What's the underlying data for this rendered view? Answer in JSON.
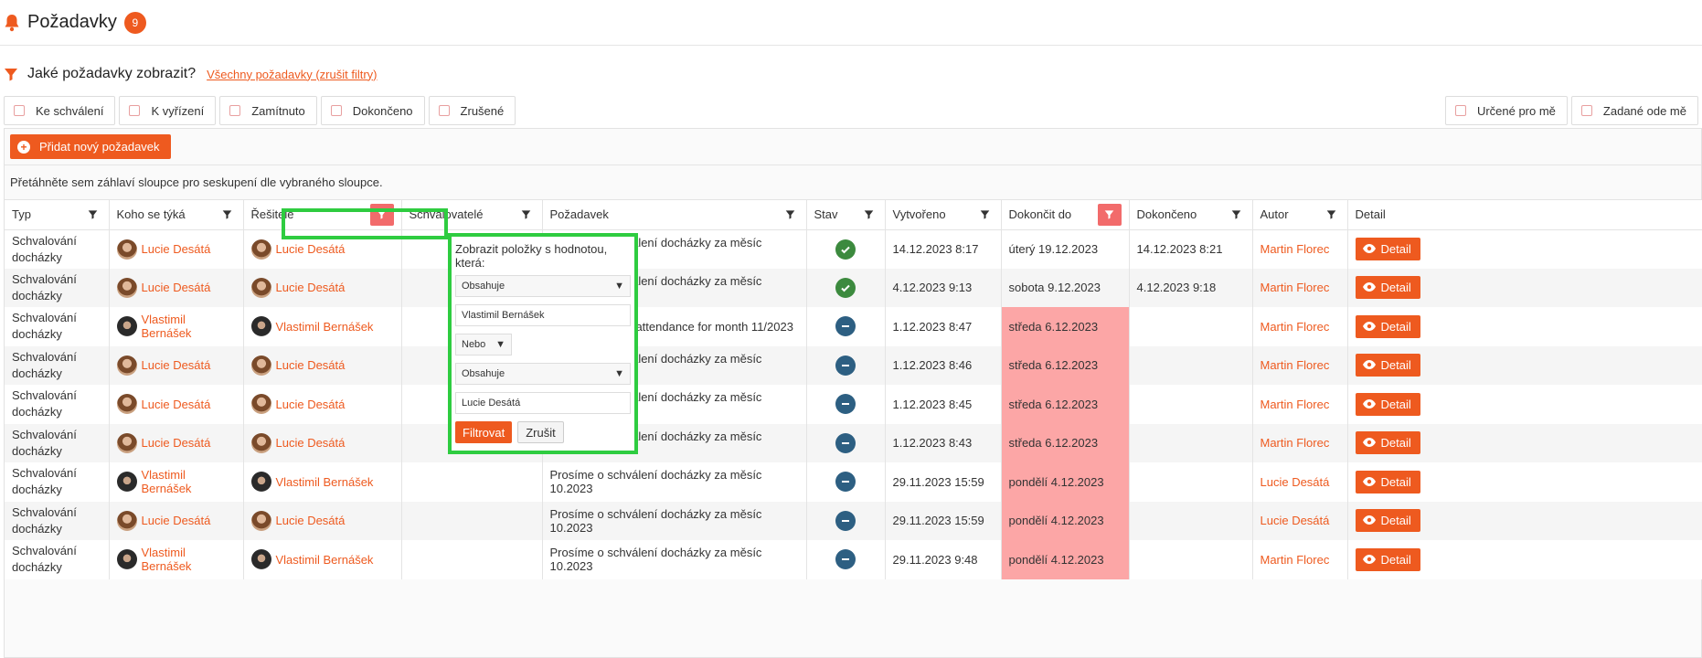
{
  "header": {
    "title": "Požadavky",
    "count": "9"
  },
  "filters": {
    "question": "Jaké požadavky zobrazit?",
    "reset": "Všechny požadavky (zrušit filtry)",
    "left_chips": [
      "Ke schválení",
      "K vyřízení",
      "Zamítnuto",
      "Dokončeno",
      "Zrušené"
    ],
    "right_chips": [
      "Určené pro mě",
      "Zadané ode mě"
    ]
  },
  "toolbar": {
    "add_label": "Přidat nový požadavek",
    "group_hint": "Přetáhněte sem záhlaví sloupce pro seskupení dle vybraného sloupce."
  },
  "columns": [
    "Typ",
    "Koho se týká",
    "Řešitelé",
    "Schvalovatelé",
    "Požadavek",
    "Stav",
    "Vytvořeno",
    "Dokončit do",
    "Dokončeno",
    "Autor",
    "Detail"
  ],
  "detail_label": "Detail",
  "rows": [
    {
      "typ": "Schvalování docházky",
      "koho": "Lucie Desátá",
      "resitel": "Lucie Desátá",
      "pozadavek": "Prosíme o schválení docházky za měsíc 11.2023",
      "stav": "done",
      "vytvoreno": "14.12.2023 8:17",
      "dokoncit": "úterý 19.12.2023",
      "overdue": false,
      "dokonceno": "14.12.2023 8:21",
      "autor": "Martin Florec"
    },
    {
      "typ": "Schvalování docházky",
      "koho": "Lucie Desátá",
      "resitel": "Lucie Desátá",
      "pozadavek": "Prosíme o schválení docházky za měsíc 11.2023",
      "stav": "done",
      "vytvoreno": "4.12.2023 9:13",
      "dokoncit": "sobota 9.12.2023",
      "overdue": false,
      "dokonceno": "4.12.2023 9:18",
      "autor": "Martin Florec"
    },
    {
      "typ": "Schvalování docházky",
      "koho": "Vlastimil Bernášek",
      "resitel": "Vlastimil Bernášek",
      "pozadavek": "Please approve attendance for month 11/2023",
      "stav": "pending",
      "vytvoreno": "1.12.2023 8:47",
      "dokoncit": "středa 6.12.2023",
      "overdue": true,
      "dokonceno": "",
      "autor": "Martin Florec"
    },
    {
      "typ": "Schvalování docházky",
      "koho": "Lucie Desátá",
      "resitel": "Lucie Desátá",
      "pozadavek": "Prosíme o schválení docházky za měsíc 11.2023",
      "stav": "pending",
      "vytvoreno": "1.12.2023 8:46",
      "dokoncit": "středa 6.12.2023",
      "overdue": true,
      "dokonceno": "",
      "autor": "Martin Florec"
    },
    {
      "typ": "Schvalování docházky",
      "koho": "Lucie Desátá",
      "resitel": "Lucie Desátá",
      "pozadavek": "Prosíme o schválení docházky za měsíc 11.2023",
      "stav": "pending",
      "vytvoreno": "1.12.2023 8:45",
      "dokoncit": "středa 6.12.2023",
      "overdue": true,
      "dokonceno": "",
      "autor": "Martin Florec"
    },
    {
      "typ": "Schvalování docházky",
      "koho": "Lucie Desátá",
      "resitel": "Lucie Desátá",
      "pozadavek": "Prosíme o schválení docházky za měsíc 11.2023",
      "stav": "pending",
      "vytvoreno": "1.12.2023 8:43",
      "dokoncit": "středa 6.12.2023",
      "overdue": true,
      "dokonceno": "",
      "autor": "Martin Florec"
    },
    {
      "typ": "Schvalování docházky",
      "koho": "Vlastimil Bernášek",
      "resitel": "Vlastimil Bernášek",
      "pozadavek": "Prosíme o schválení docházky za měsíc 10.2023",
      "stav": "pending",
      "vytvoreno": "29.11.2023 15:59",
      "dokoncit": "pondělí 4.12.2023",
      "overdue": true,
      "dokonceno": "",
      "autor": "Lucie Desátá"
    },
    {
      "typ": "Schvalování docházky",
      "koho": "Lucie Desátá",
      "resitel": "Lucie Desátá",
      "pozadavek": "Prosíme o schválení docházky za měsíc 10.2023",
      "stav": "pending",
      "vytvoreno": "29.11.2023 15:59",
      "dokoncit": "pondělí 4.12.2023",
      "overdue": true,
      "dokonceno": "",
      "autor": "Lucie Desátá"
    },
    {
      "typ": "Schvalování docházky",
      "koho": "Vlastimil Bernášek",
      "resitel": "Vlastimil Bernášek",
      "pozadavek": "Prosíme o schválení docházky za měsíc 10.2023",
      "stav": "pending",
      "vytvoreno": "29.11.2023 9:48",
      "dokoncit": "pondělí 4.12.2023",
      "overdue": true,
      "dokonceno": "",
      "autor": "Martin Florec"
    }
  ],
  "popup": {
    "title": "Zobrazit položky s hodnotou, která:",
    "op1": "Obsahuje",
    "value1": "Vlastimil Bernášek",
    "logic": "Nebo",
    "op2": "Obsahuje",
    "value2": "Lucie Desátá",
    "filter_label": "Filtrovat",
    "cancel_label": "Zrušit"
  },
  "colors": {
    "accent": "#ee5a1f",
    "overdue": "#fca6a6",
    "highlight": "#2ecc40",
    "done": "#3c8a3e",
    "pending": "#2d5f82"
  }
}
